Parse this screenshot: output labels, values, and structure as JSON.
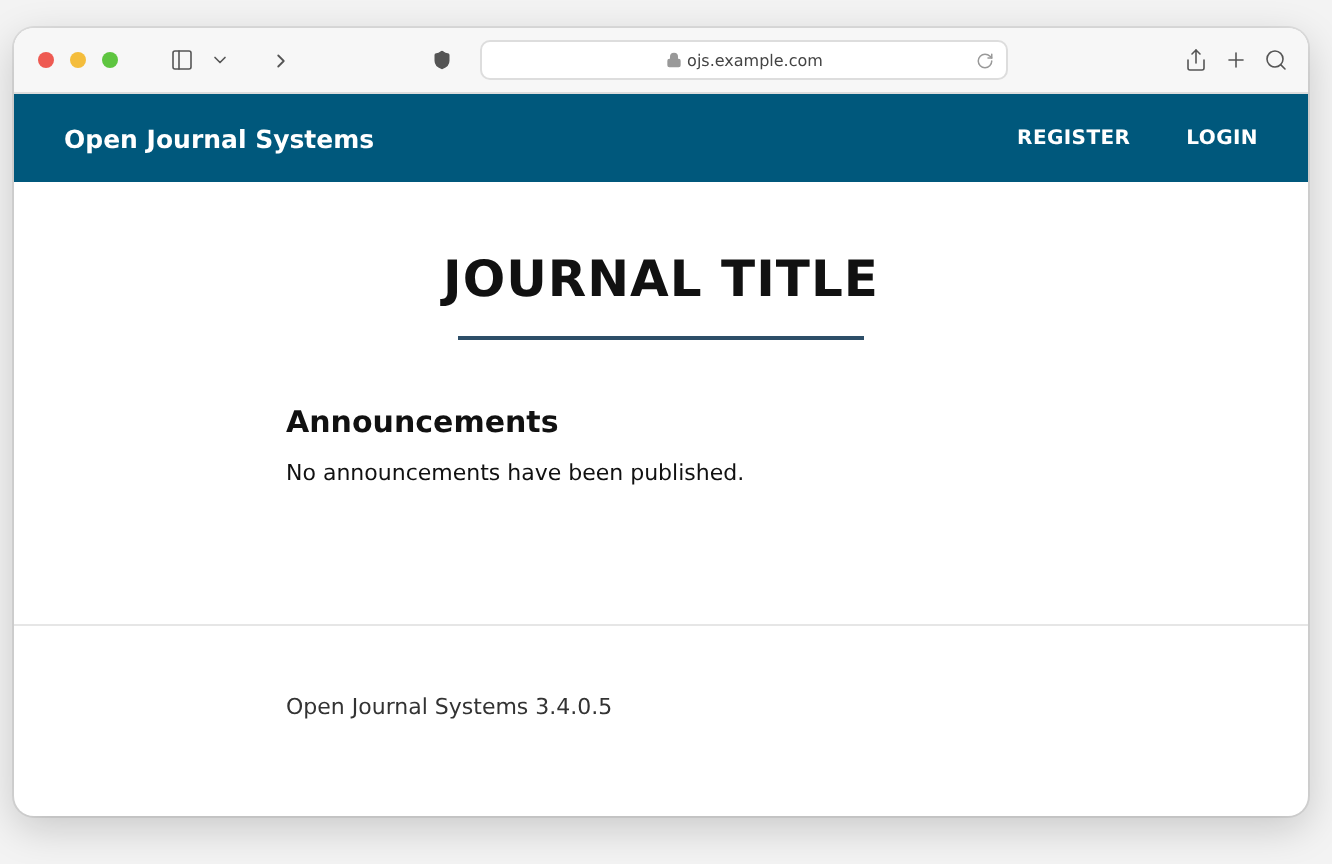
{
  "browser": {
    "address": "ojs.example.com"
  },
  "header": {
    "site_name": "Open Journal Systems",
    "nav": [
      "REGISTER",
      "LOGIN"
    ]
  },
  "main": {
    "title": "JOURNAL TITLE",
    "section_heading": "Announcements",
    "message": "No announcements have been published."
  },
  "footer": {
    "text": "Open Journal Systems 3.4.0.5"
  }
}
